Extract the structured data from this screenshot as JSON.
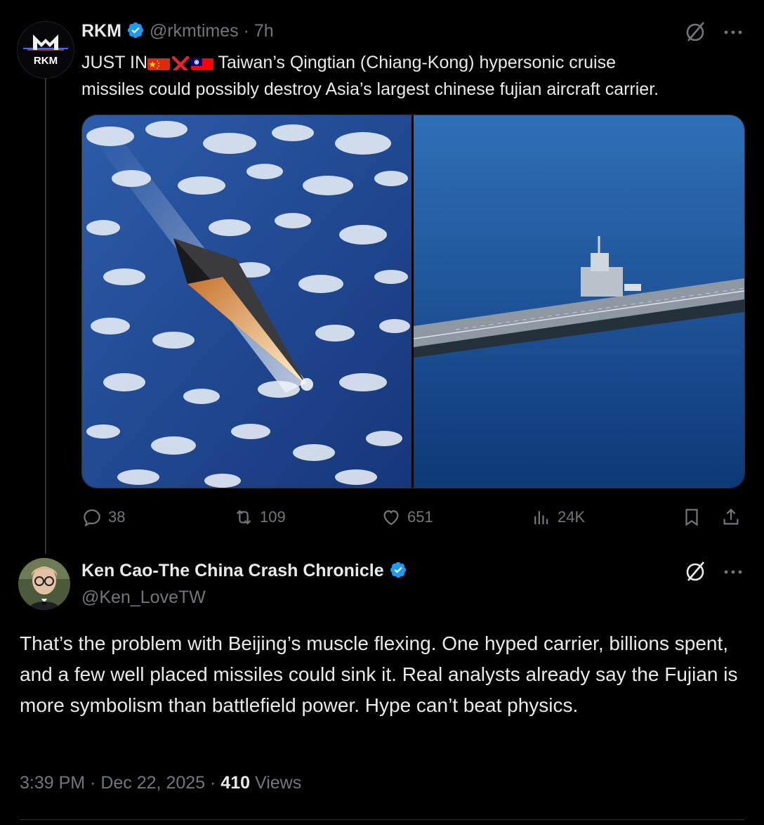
{
  "tweet": {
    "author_name": "RKM",
    "handle": "@rkmtimes",
    "dot": "·",
    "time": "7h",
    "avatar_text": "RKM",
    "text_prefix": "JUST IN",
    "text_suffix": " Taiwan’s Qingtian (Chiang-Kong) hypersonic cruise",
    "text_line2": "missiles could possibly destroy Asia’s largest chinese fujian aircraft carrier.",
    "flags": [
      "china-flag-icon",
      "cross-mark-icon",
      "taiwan-flag-icon"
    ],
    "media": [
      "hypersonic-missile-over-clouds-image",
      "aircraft-carrier-at-sea-image"
    ],
    "stats": {
      "replies": "38",
      "reposts": "109",
      "likes": "651",
      "views": "24K"
    }
  },
  "reply": {
    "author_name": "Ken Cao-The China Crash Chronicle",
    "handle": "@Ken_LoveTW",
    "text": "That’s the problem with Beijing’s muscle flexing. One hyped carrier, billions spent, and a few well placed missiles could sink it. Real analysts already say the Fujian is more symbolism than battlefield power. Hype can’t beat physics.",
    "time": "3:39 PM",
    "sep": "·",
    "date": "Dec 22, 2025",
    "view_count": "410",
    "views_label": "Views"
  },
  "colors": {
    "background": "#000000",
    "text": "#e7e9ea",
    "muted": "#71767b",
    "verified": "#1d9bf0"
  }
}
